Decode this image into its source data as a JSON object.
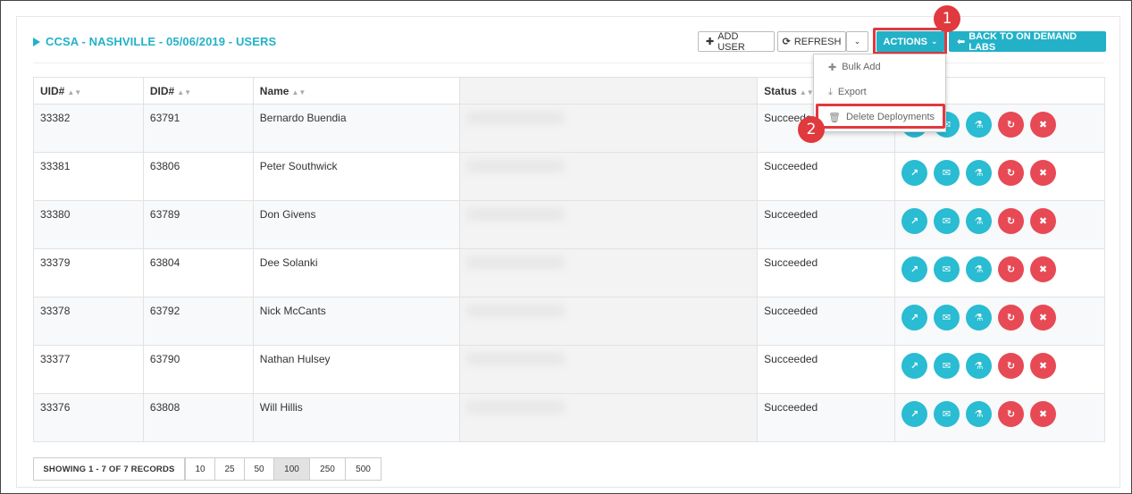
{
  "header": {
    "title": "CCSA - NASHVILLE - 05/06/2019 - USERS",
    "add_user": "ADD USER",
    "refresh": "REFRESH",
    "actions": "ACTIONS",
    "back": "BACK TO ON DEMAND LABS"
  },
  "dropdown": {
    "items": [
      {
        "label": "Bulk Add",
        "icon": "plus-icon"
      },
      {
        "label": "Export",
        "icon": "download-icon"
      },
      {
        "label": "Delete Deployments",
        "icon": "trash-icon"
      }
    ]
  },
  "callouts": {
    "one": "1",
    "two": "2"
  },
  "table": {
    "headers": [
      "UID#",
      "DID#",
      "Name",
      "",
      "Status",
      ""
    ],
    "rows": [
      {
        "uid": "33382",
        "did": "63791",
        "name": "Bernardo Buendia",
        "status": "Succeeded"
      },
      {
        "uid": "33381",
        "did": "63806",
        "name": "Peter Southwick",
        "status": "Succeeded"
      },
      {
        "uid": "33380",
        "did": "63789",
        "name": "Don Givens",
        "status": "Succeeded"
      },
      {
        "uid": "33379",
        "did": "63804",
        "name": "Dee Solanki",
        "status": "Succeeded"
      },
      {
        "uid": "33378",
        "did": "63792",
        "name": "Nick McCants",
        "status": "Succeeded"
      },
      {
        "uid": "33377",
        "did": "63790",
        "name": "Nathan Hulsey",
        "status": "Succeeded"
      },
      {
        "uid": "33376",
        "did": "63808",
        "name": "Will Hillis",
        "status": "Succeeded"
      }
    ],
    "row_actions": [
      {
        "name": "open-external-icon",
        "glyph": "↗",
        "color": "#29bcd2"
      },
      {
        "name": "email-icon",
        "glyph": "✉",
        "color": "#29bcd2"
      },
      {
        "name": "flask-icon",
        "glyph": "⚗",
        "color": "#29bcd2"
      },
      {
        "name": "reset-icon",
        "glyph": "↻",
        "color": "#e74a55"
      },
      {
        "name": "delete-icon",
        "glyph": "✖",
        "color": "#e74a55"
      }
    ]
  },
  "pager": {
    "info": "SHOWING 1 - 7 OF 7 RECORDS",
    "sizes": [
      "10",
      "25",
      "50",
      "100",
      "250",
      "500"
    ],
    "active": "100"
  },
  "colors": {
    "accent": "#23b1c8",
    "danger": "#e0393e"
  }
}
